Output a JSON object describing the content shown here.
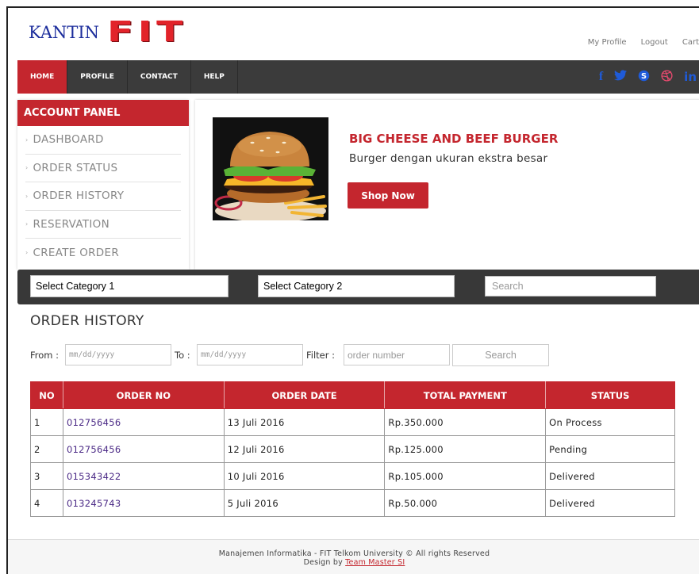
{
  "header": {
    "logo_text": "KANTIN",
    "logo_brand": "FIT",
    "links": [
      "My Profile",
      "Logout",
      "Cart"
    ]
  },
  "nav": {
    "items": [
      "HOME",
      "PROFILE",
      "CONTACT",
      "HELP"
    ],
    "active": "HOME",
    "social": [
      "f",
      "t",
      "S",
      "D",
      "in"
    ]
  },
  "account_panel": {
    "title": "ACCOUNT PANEL",
    "items": [
      "DASHBOARD",
      "ORDER STATUS",
      "ORDER HISTORY",
      "RESERVATION",
      "CREATE ORDER"
    ]
  },
  "banner": {
    "title": "BIG CHEESE AND BEEF BURGER",
    "subtitle": "Burger dengan ukuran ekstra besar",
    "button": "Shop Now"
  },
  "filter_bar": {
    "category1": "Select Category 1",
    "category2": "Select Category 2",
    "search_placeholder": "Search"
  },
  "order_history": {
    "title": "ORDER HISTORY",
    "from_label": "From :",
    "to_label": "To :",
    "filter_label": "Filter :",
    "date_placeholder": "mm/dd/yyyy",
    "filter_placeholder": "order number",
    "search_button": "Search",
    "columns": [
      "NO",
      "ORDER NO",
      "ORDER DATE",
      "TOTAL PAYMENT",
      "STATUS"
    ],
    "rows": [
      [
        "1",
        "012756456",
        "13 Juli 2016",
        "Rp.350.000",
        "On Process"
      ],
      [
        "2",
        "012756456",
        "12 Juli 2016",
        "Rp.125.000",
        "Pending"
      ],
      [
        "3",
        "015343422",
        "10 Juli 2016",
        "Rp.105.000",
        "Delivered"
      ],
      [
        "4",
        "013245743",
        "5 Juli 2016",
        "Rp.50.000",
        "Delivered"
      ]
    ]
  },
  "footer": {
    "line1": "Manajemen Informatika - FIT Telkom University © All rights Reserved",
    "line2_prefix": "Design by",
    "line2_link": "Team Master SI"
  },
  "colors": {
    "brand_red": "#c4262e",
    "nav_dark": "#3b3b3b",
    "logo_blue": "#1c2d9c",
    "social_blue": "#1f5bd9"
  }
}
